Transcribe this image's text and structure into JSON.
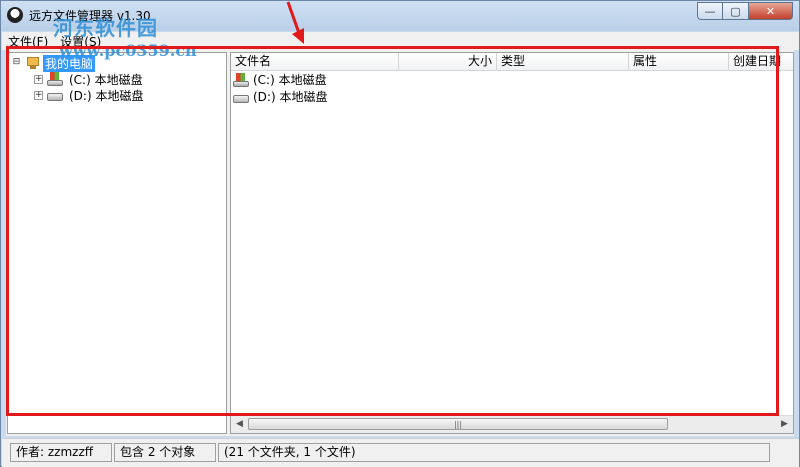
{
  "window": {
    "title": "远方文件管理器 v1.30",
    "controls": {
      "minimize": "—",
      "maximize": "▢",
      "close": "✕"
    }
  },
  "menubar": {
    "items": [
      "文件(F)",
      "设置(S)"
    ]
  },
  "tree": {
    "root": {
      "label": "我的电脑",
      "expander": "⊟"
    },
    "children": [
      {
        "label": "(C:) 本地磁盘",
        "expander": "+"
      },
      {
        "label": "(D:) 本地磁盘",
        "expander": "+"
      }
    ]
  },
  "list": {
    "columns": [
      "文件名",
      "大小",
      "类型",
      "属性",
      "创建日期"
    ],
    "rows": [
      {
        "name": "(C:) 本地磁盘"
      },
      {
        "name": "(D:) 本地磁盘"
      }
    ],
    "scroll": {
      "left": "◀",
      "right": "▶",
      "grip": "|||"
    }
  },
  "statusbar": {
    "author": "作者: zzmzzff",
    "count": "包含 2 个对象",
    "detail": "(21 个文件夹, 1 个文件)"
  },
  "watermark": {
    "title": "河东软件园",
    "url": "www.pc0359.cn"
  },
  "colors": {
    "highlight": "#e1191a",
    "selection": "#3399ff",
    "watermark": "#2f8fd6"
  }
}
